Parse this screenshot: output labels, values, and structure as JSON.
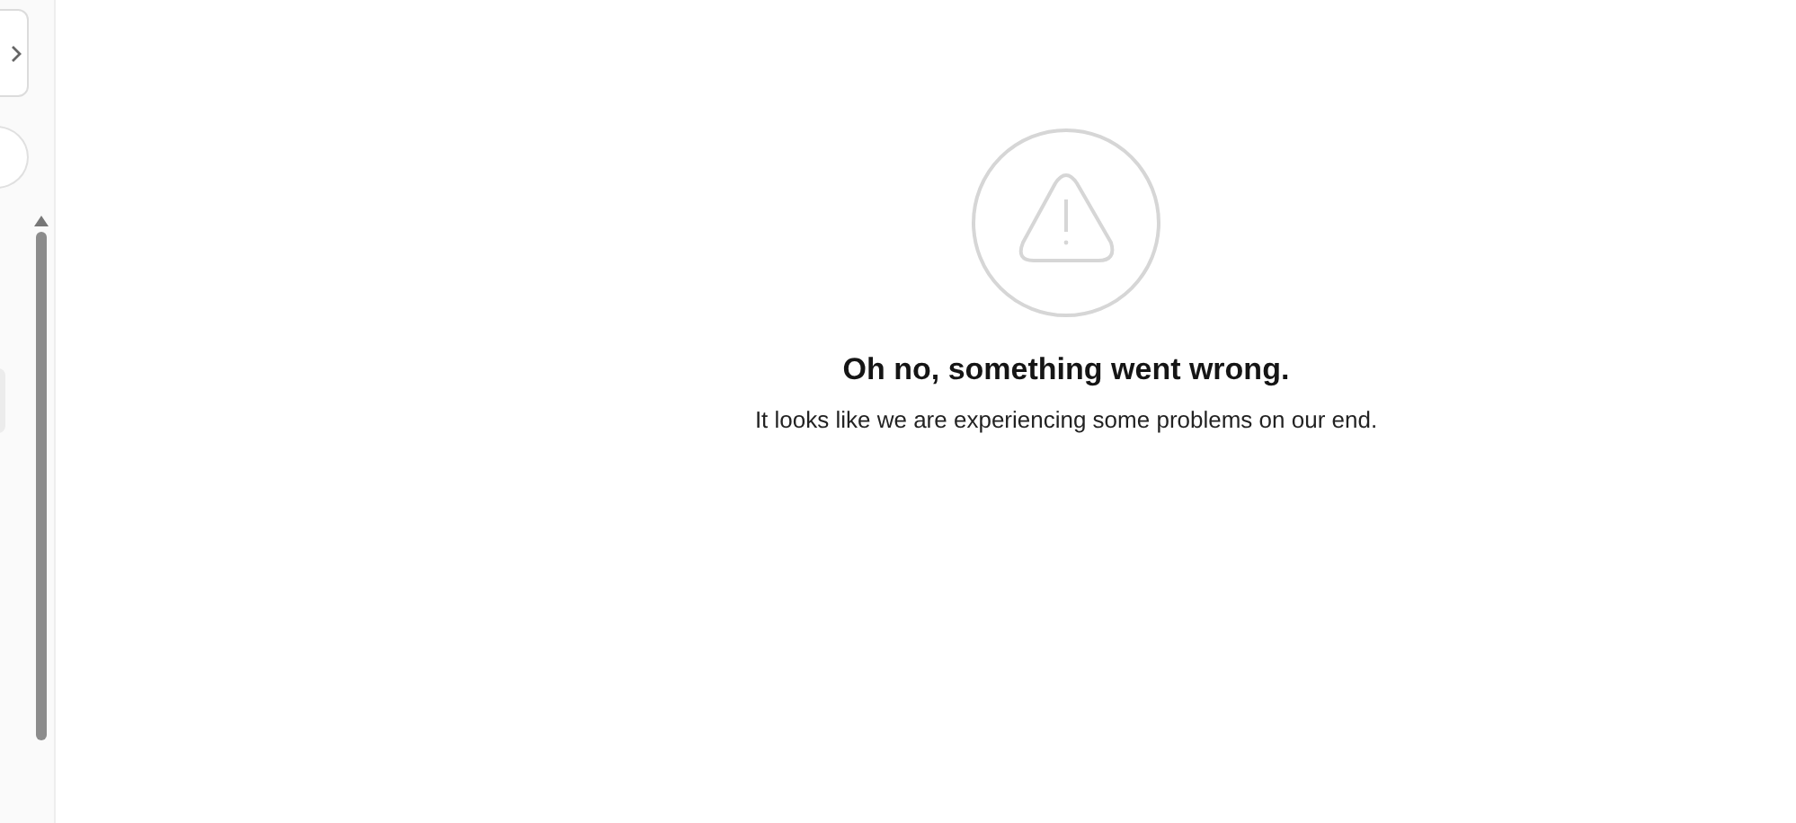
{
  "error": {
    "title": "Oh no, something went wrong.",
    "message": "It looks like we are experiencing some problems on our end."
  }
}
